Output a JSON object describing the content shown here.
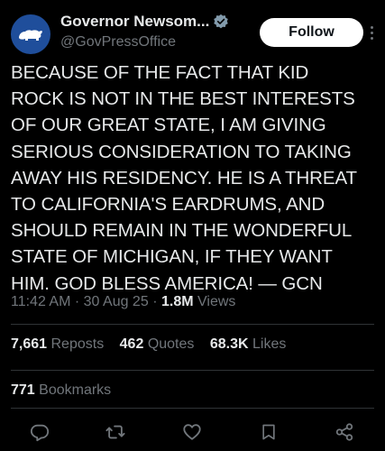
{
  "post": {
    "author": {
      "display_name": "Governor Newsom...",
      "handle": "@GovPressOffice",
      "avatar_icon": "california-bear-icon",
      "verified_icon": "verified-badge-icon"
    },
    "follow_label": "Follow",
    "more_icon": "more-options-icon",
    "text": "BECAUSE OF THE FACT THAT KID\nROCK IS NOT IN THE BEST INTERESTS\nOF OUR GREAT STATE, I AM GIVING\nSERIOUS CONSIDERATION TO TAKING\nAWAY HIS RESIDENCY. HE IS A THREAT\nTO CALIFORNIA'S EARDRUMS, AND\nSHOULD REMAIN IN THE WONDERFUL\nSTATE OF MICHIGAN, IF THEY WANT\nHIM. GOD BLESS AMERICA! — GCN",
    "time": "11:42 AM",
    "date": "30 Aug 25",
    "separator": "·",
    "views_count": "1.8M",
    "views_label": "Views",
    "stats": {
      "reposts_count": "7,661",
      "reposts_label": "Reposts",
      "quotes_count": "462",
      "quotes_label": "Quotes",
      "likes_count": "68.3K",
      "likes_label": "Likes"
    },
    "bookmarks": {
      "count": "771",
      "label": "Bookmarks"
    },
    "actions": [
      {
        "icon": "reply-icon"
      },
      {
        "icon": "repost-icon"
      },
      {
        "icon": "like-icon"
      },
      {
        "icon": "bookmark-icon"
      },
      {
        "icon": "share-icon"
      }
    ]
  },
  "colors": {
    "background": "#000000",
    "text_primary": "#e7e9ea",
    "text_secondary": "#71767b",
    "divider": "#2f3336",
    "verified": "#829aab",
    "avatar": "#1f4e9b"
  }
}
